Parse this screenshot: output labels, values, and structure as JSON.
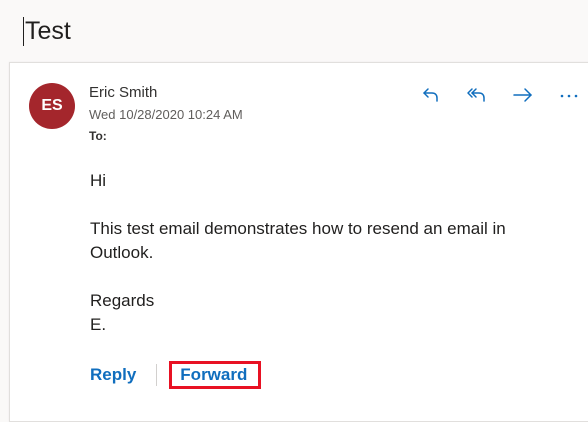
{
  "message": {
    "subject": "Test",
    "avatar_initials": "ES",
    "avatar_color": "#a4262c",
    "sender_name": "Eric Smith",
    "date": "Wed 10/28/2020 10:24 AM",
    "to_label": "To:",
    "body_lines": {
      "greeting": "Hi",
      "line1": "This test email demonstrates how to resend an email in",
      "line2": "Outlook.",
      "closing": "Regards",
      "signature": "E."
    }
  },
  "toolbar": {
    "actions": [
      "reply-icon",
      "reply-all-icon",
      "forward-icon",
      "more-icon"
    ],
    "icon_color": "#106ebe"
  },
  "footer": {
    "reply_label": "Reply",
    "forward_label": "Forward",
    "highlight_color": "#e81123"
  }
}
